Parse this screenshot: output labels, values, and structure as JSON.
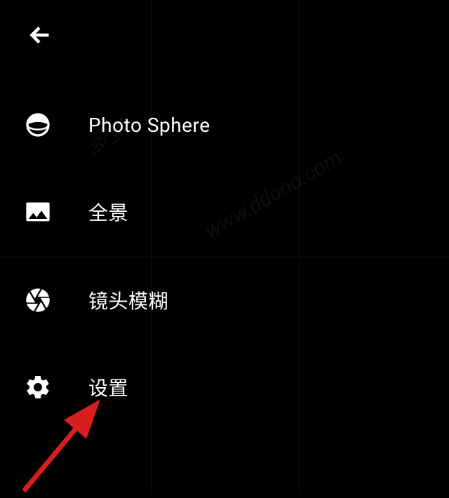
{
  "menu": {
    "items": [
      {
        "label": "Photo Sphere",
        "icon": "photo-sphere-icon"
      },
      {
        "label": "全景",
        "icon": "panorama-icon"
      },
      {
        "label": "镜头模糊",
        "icon": "lens-blur-icon"
      },
      {
        "label": "设置",
        "icon": "settings-icon"
      }
    ]
  },
  "watermark": {
    "text1": "多多",
    "text2": "www.ddooo.com"
  }
}
